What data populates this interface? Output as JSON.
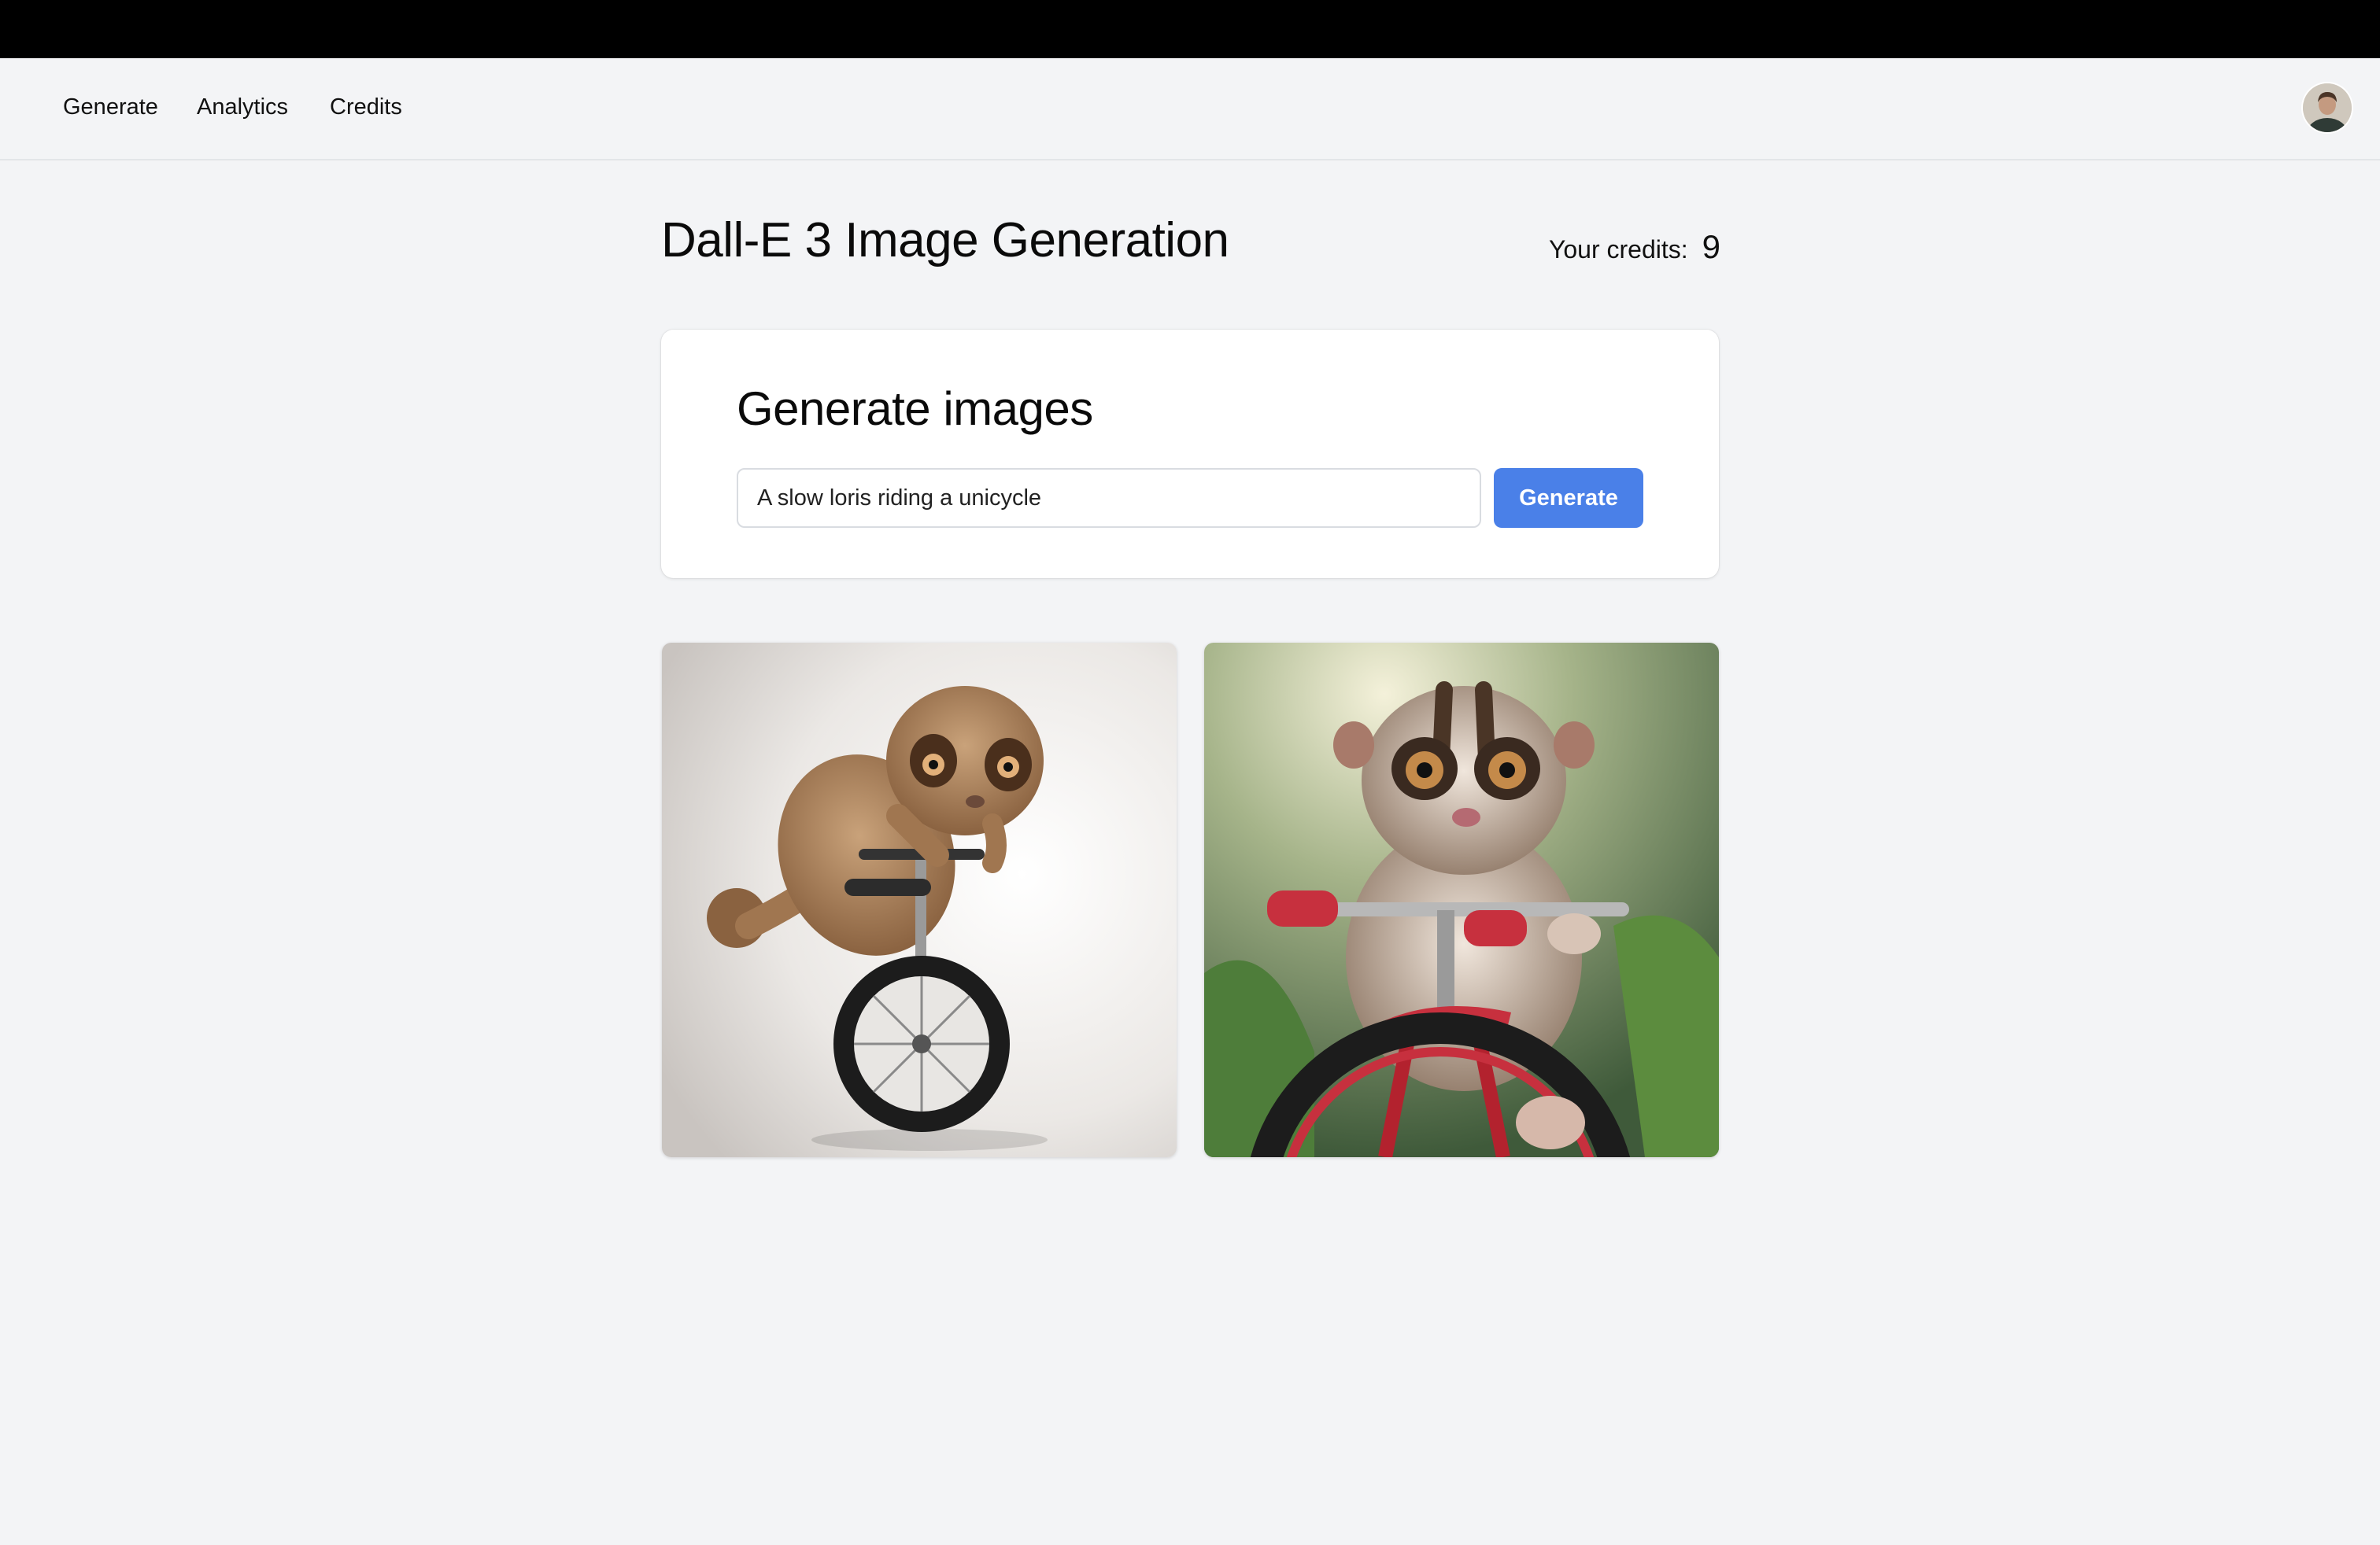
{
  "nav": {
    "links": [
      "Generate",
      "Analytics",
      "Credits"
    ]
  },
  "page": {
    "title": "Dall-E 3 Image Generation",
    "credits_label": "Your credits:",
    "credits_value": "9"
  },
  "generator": {
    "title": "Generate images",
    "prompt_value": "A slow loris riding a unicycle",
    "button_label": "Generate"
  },
  "results": [
    {
      "subject": "slow loris on a unicycle",
      "background": "light studio"
    },
    {
      "subject": "slow loris on a red bicycle",
      "background": "green foliage"
    }
  ],
  "colors": {
    "accent": "#4a80e8",
    "page_bg": "#f3f4f6",
    "top_bar": "#000000"
  }
}
